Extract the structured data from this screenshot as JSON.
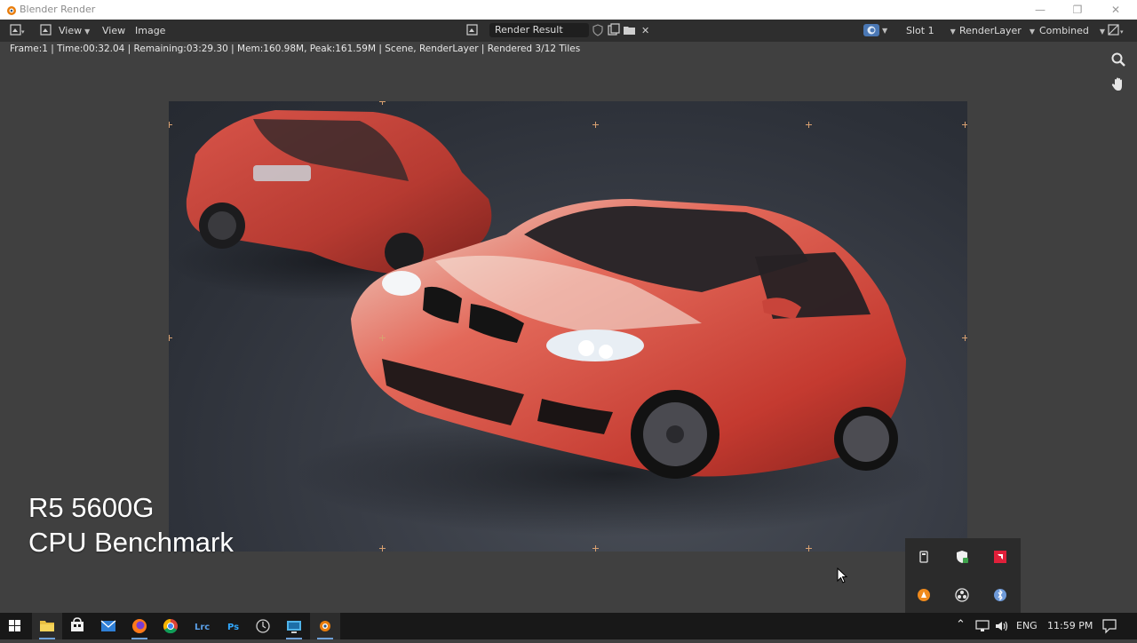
{
  "window": {
    "title": "Blender Render",
    "controls": {
      "minimize": "—",
      "restore": "❐",
      "close": "✕"
    }
  },
  "header": {
    "menus": [
      "View",
      "View",
      "Image"
    ],
    "image_name": "Render Result",
    "slot": "Slot 1",
    "layer": "RenderLayer",
    "pass": "Combined"
  },
  "info": {
    "status": "Frame:1 | Time:00:32.04 | Remaining:03:29.30 | Mem:160.98M, Peak:161.59M | Scene, RenderLayer | Rendered 3/12 Tiles"
  },
  "overlay": {
    "line1": "R5 5600G",
    "line2": "CPU Benchmark"
  },
  "taskbar": {
    "language": "ENG",
    "time": "11:59 PM",
    "apps": [
      "start-icon",
      "file-explorer-icon",
      "store-icon",
      "mail-icon",
      "firefox-icon",
      "chrome-icon",
      "lightroom-icon",
      "photoshop-icon",
      "clock-icon",
      "remote-desktop-icon",
      "blender-icon"
    ]
  },
  "tray_popup": {
    "icons": [
      "usb-icon",
      "defender-icon",
      "amd-icon",
      "vlc-icon",
      "obs-icon",
      "bluetooth-icon"
    ]
  },
  "colors": {
    "accent": "#6ea0d8",
    "tile_marker": "#d8a070",
    "car_red": "#c8443a",
    "amd_red": "#e0203a"
  }
}
